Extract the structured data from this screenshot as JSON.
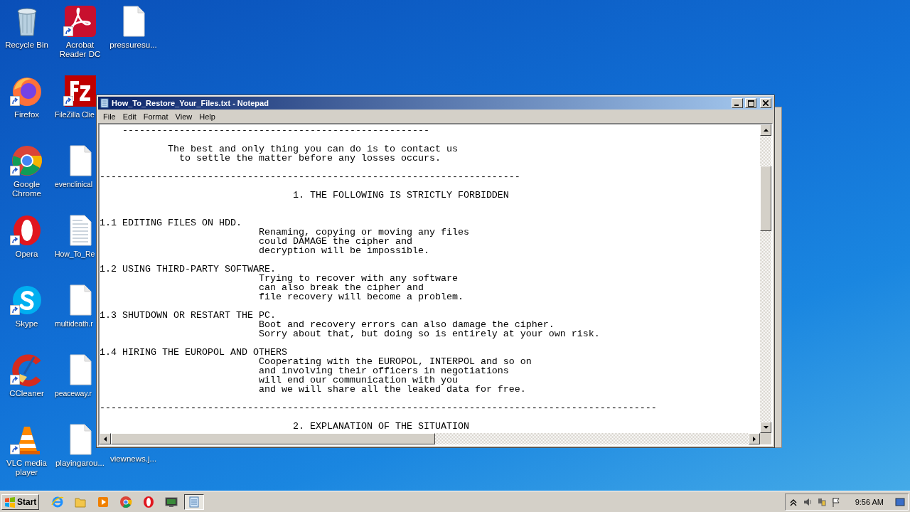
{
  "desktop": {
    "columns": [
      {
        "icons": [
          {
            "label": "Recycle Bin",
            "kind": "recycle-bin",
            "shortcut": false
          },
          {
            "label": "Firefox",
            "kind": "firefox",
            "shortcut": true
          },
          {
            "label": "Google Chrome",
            "kind": "chrome",
            "shortcut": true
          },
          {
            "label": "Opera",
            "kind": "opera",
            "shortcut": true
          },
          {
            "label": "Skype",
            "kind": "skype",
            "shortcut": true
          },
          {
            "label": "CCleaner",
            "kind": "ccleaner",
            "shortcut": true
          },
          {
            "label": "VLC media player",
            "kind": "vlc",
            "shortcut": true
          }
        ]
      },
      {
        "icons": [
          {
            "label": "Acrobat Reader DC",
            "kind": "acrobat",
            "shortcut": true
          },
          {
            "label": "FileZilla Clie",
            "kind": "filezilla",
            "shortcut": true
          },
          {
            "label": "evenclinical",
            "kind": "file",
            "shortcut": false
          },
          {
            "label": "How_To_Re",
            "kind": "text-file",
            "shortcut": false
          },
          {
            "label": "multideath.r",
            "kind": "file",
            "shortcut": false
          },
          {
            "label": "peaceway.r",
            "kind": "file",
            "shortcut": false
          },
          {
            "label": "playingarou...",
            "kind": "file",
            "shortcut": false
          }
        ]
      },
      {
        "icons": [
          {
            "label": "pressuresu...",
            "kind": "file",
            "shortcut": false
          },
          {
            "label": "viewnews.j...",
            "shortcut": false
          }
        ]
      }
    ]
  },
  "window": {
    "title": "How_To_Restore_Your_Files.txt - Notepad",
    "menu": [
      "File",
      "Edit",
      "Format",
      "View",
      "Help"
    ],
    "text": "    ------------------------------------------------------\n\n            The best and only thing you can do is to contact us\n              to settle the matter before any losses occurs.\n\n--------------------------------------------------------------------------\n\n                                  1. THE FOLLOWING IS STRICTLY FORBIDDEN\n\n\n1.1 EDITING FILES ON HDD.\n                            Renaming, copying or moving any files\n                            could DAMAGE the cipher and\n                            decryption will be impossible.\n\n1.2 USING THIRD-PARTY SOFTWARE.\n                            Trying to recover with any software\n                            can also break the cipher and\n                            file recovery will become a problem.\n\n1.3 SHUTDOWN OR RESTART THE PC.\n                            Boot and recovery errors can also damage the cipher.\n                            Sorry about that, but doing so is entirely at your own risk.\n\n1.4 HIRING THE EUROPOL AND OTHERS\n                            Cooperating with the EUROPOL, INTERPOL and so on\n                            and involving their officers in negotiations\n                            will end our communication with you\n                            and we will share all the leaked data for free.\n\n--------------------------------------------------------------------------------------------------\n\n                                  2. EXPLANATION OF THE SITUATION"
  },
  "taskbar": {
    "start": "Start",
    "items": [
      {
        "kind": "ie",
        "selected": false
      },
      {
        "kind": "folder",
        "selected": false
      },
      {
        "kind": "media-player",
        "selected": false
      },
      {
        "kind": "chrome",
        "selected": false
      },
      {
        "kind": "opera",
        "selected": false
      },
      {
        "kind": "monitor",
        "selected": false
      },
      {
        "kind": "notepad",
        "selected": true
      }
    ],
    "tray": [
      {
        "kind": "chevron"
      },
      {
        "kind": "speaker"
      },
      {
        "kind": "network"
      },
      {
        "kind": "flag"
      }
    ],
    "clock": "9:56 AM"
  }
}
